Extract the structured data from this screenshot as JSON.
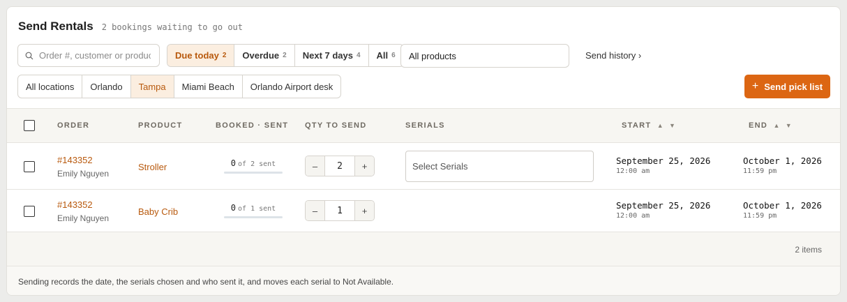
{
  "header": {
    "title": "Send Rentals",
    "subtitle": "2 bookings waiting to go out"
  },
  "search": {
    "placeholder": "Order #, customer or product"
  },
  "status_filters": [
    {
      "label": "Due today",
      "count": "2",
      "active": true
    },
    {
      "label": "Overdue",
      "count": "2",
      "active": false
    },
    {
      "label": "Next 7 days",
      "count": "4",
      "active": false
    },
    {
      "label": "All",
      "count": "6",
      "active": false
    }
  ],
  "product_filter": {
    "value": "All products"
  },
  "history_link": "Send history ›",
  "locations": [
    {
      "label": "All locations",
      "active": false
    },
    {
      "label": "Orlando",
      "active": false
    },
    {
      "label": "Tampa",
      "active": true
    },
    {
      "label": "Miami Beach",
      "active": false
    },
    {
      "label": "Orlando Airport desk",
      "active": false
    }
  ],
  "pick_button": {
    "plus": "+",
    "label": "Send pick list"
  },
  "columns": {
    "order": "ORDER",
    "product": "PRODUCT",
    "booked": "BOOKED · SENT",
    "qty": "QTY TO SEND",
    "serials": "SERIALS",
    "start": "START",
    "end": "END",
    "sort_up": "▲",
    "sort_down": "▼"
  },
  "rows": [
    {
      "order": "#143352",
      "customer": "Emily Nguyen",
      "product": "Stroller",
      "sent": "0",
      "of_booked": "of 2 sent",
      "sent_fraction": 0,
      "qty": "2",
      "serials_placeholder": "Select Serials",
      "start_date": "September 25, 2026",
      "start_time": "12:00 am",
      "end_date": "October 1, 2026",
      "end_time": "11:59 pm"
    },
    {
      "order": "#143352",
      "customer": "Emily Nguyen",
      "product": "Baby Crib",
      "sent": "0",
      "of_booked": "of 1 sent",
      "sent_fraction": 0,
      "qty": "1",
      "start_date": "September 25, 2026",
      "start_time": "12:00 am",
      "end_date": "October 1, 2026",
      "end_time": "11:59 pm"
    }
  ],
  "stepper": {
    "minus": "–",
    "plus": "+"
  },
  "summary": {
    "count": "2 items"
  },
  "footer": {
    "note": "Sending records the date, the serials chosen and who sent it, and moves each serial to Not Available."
  },
  "colors": {
    "accent": "#dc6613",
    "link": "#b8590d",
    "active_bg": "#fbeee0"
  }
}
